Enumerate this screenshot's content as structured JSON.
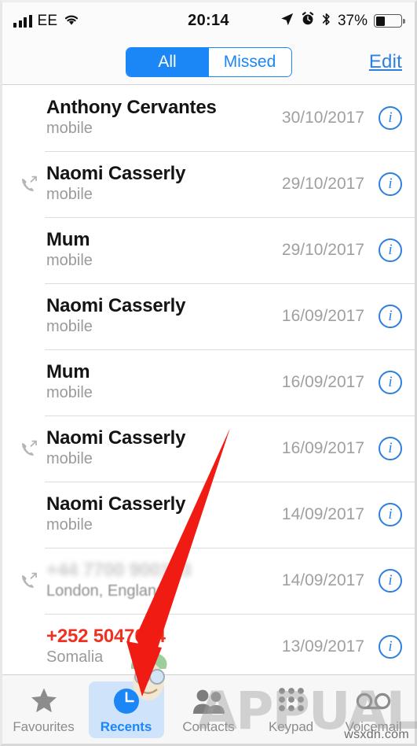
{
  "status_bar": {
    "carrier": "EE",
    "signal_bars": 4,
    "wifi_icon": "wifi-icon",
    "time": "20:14",
    "location_icon": "location-arrow-icon",
    "alarm_icon": "alarm-clock-icon",
    "bluetooth_icon": "bluetooth-icon",
    "battery_percent": "37%",
    "battery_level": 37
  },
  "nav_bar": {
    "segments": [
      {
        "label": "All",
        "selected": true
      },
      {
        "label": "Missed",
        "selected": false
      }
    ],
    "edit_label": "Edit"
  },
  "colors": {
    "accent_blue": "#1b87f7",
    "link_blue": "#2d7fe0",
    "missed_red": "#ef3124",
    "tab_active_bg": "#cfe4fb",
    "gray_text": "#9a9a9a",
    "annotation_red": "#f01b13"
  },
  "calls": [
    {
      "name": "Anthony Cervantes",
      "detail": "mobile",
      "date": "30/10/2017",
      "direction": "none",
      "missed": false,
      "redacted": false,
      "info_icon": "info-circle-icon"
    },
    {
      "name": "Naomi Casserly",
      "detail": "mobile",
      "date": "29/10/2017",
      "direction": "outgoing",
      "missed": false,
      "redacted": false,
      "info_icon": "info-circle-icon"
    },
    {
      "name": "Mum",
      "detail": "mobile",
      "date": "29/10/2017",
      "direction": "none",
      "missed": false,
      "redacted": false,
      "info_icon": "info-circle-icon"
    },
    {
      "name": "Naomi Casserly",
      "detail": "mobile",
      "date": "16/09/2017",
      "direction": "none",
      "missed": false,
      "redacted": false,
      "info_icon": "info-circle-icon"
    },
    {
      "name": "Mum",
      "detail": "mobile",
      "date": "16/09/2017",
      "direction": "none",
      "missed": false,
      "redacted": false,
      "info_icon": "info-circle-icon"
    },
    {
      "name": "Naomi Casserly",
      "detail": "mobile",
      "date": "16/09/2017",
      "direction": "outgoing",
      "missed": false,
      "redacted": false,
      "info_icon": "info-circle-icon"
    },
    {
      "name": "Naomi Casserly",
      "detail": "mobile",
      "date": "14/09/2017",
      "direction": "none",
      "missed": false,
      "redacted": false,
      "info_icon": "info-circle-icon"
    },
    {
      "name": "+44 7700 900123",
      "detail": "London, England",
      "date": "14/09/2017",
      "direction": "outgoing",
      "missed": false,
      "redacted": true,
      "info_icon": "info-circle-icon"
    },
    {
      "name": "+252 5047014",
      "detail": "Somalia",
      "date": "13/09/2017",
      "direction": "none",
      "missed": true,
      "redacted": false,
      "info_icon": "info-circle-icon"
    }
  ],
  "tab_bar": {
    "tabs": [
      {
        "label": "Favourites",
        "icon": "star-icon",
        "active": false
      },
      {
        "label": "Recents",
        "icon": "clock-icon",
        "active": true
      },
      {
        "label": "Contacts",
        "icon": "people-icon",
        "active": false
      },
      {
        "label": "Keypad",
        "icon": "keypad-dots-icon",
        "active": false
      },
      {
        "label": "Voicemail",
        "icon": "voicemail-icon",
        "active": false
      }
    ]
  },
  "annotations": {
    "arrow": "red-arrow-pointing-to-recents-tab",
    "watermark_text": "APPUALS",
    "watermark_site": "wsxdn.com"
  }
}
